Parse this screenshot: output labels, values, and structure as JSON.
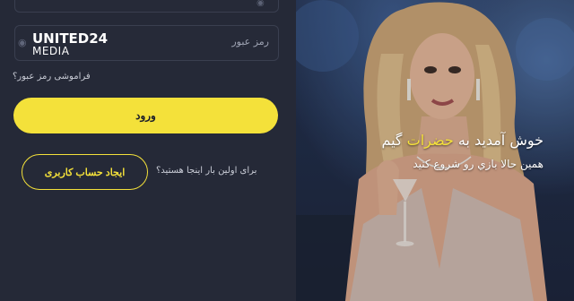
{
  "login_form": {
    "password_label": "رمز عبور",
    "forgot_password": "فراموشی رمز عبور؟",
    "login_button": "ورود",
    "first_time_text": "برای اولین بار اینجا هستید؟",
    "register_button": "ایجاد حساب کاربری"
  },
  "watermark": {
    "line1": "UNITED24",
    "line2": "MEDIA"
  },
  "hero": {
    "title_before": "خوش آمدید به",
    "title_highlight": "حضرات",
    "title_after": "گیم",
    "subtitle": "همین حالا بازي رو شروع کنید"
  },
  "colors": {
    "background": "#252937",
    "accent": "#f4e13a",
    "field_border": "#3a3f50"
  },
  "icons": {
    "password_toggle": "eye-icon"
  }
}
